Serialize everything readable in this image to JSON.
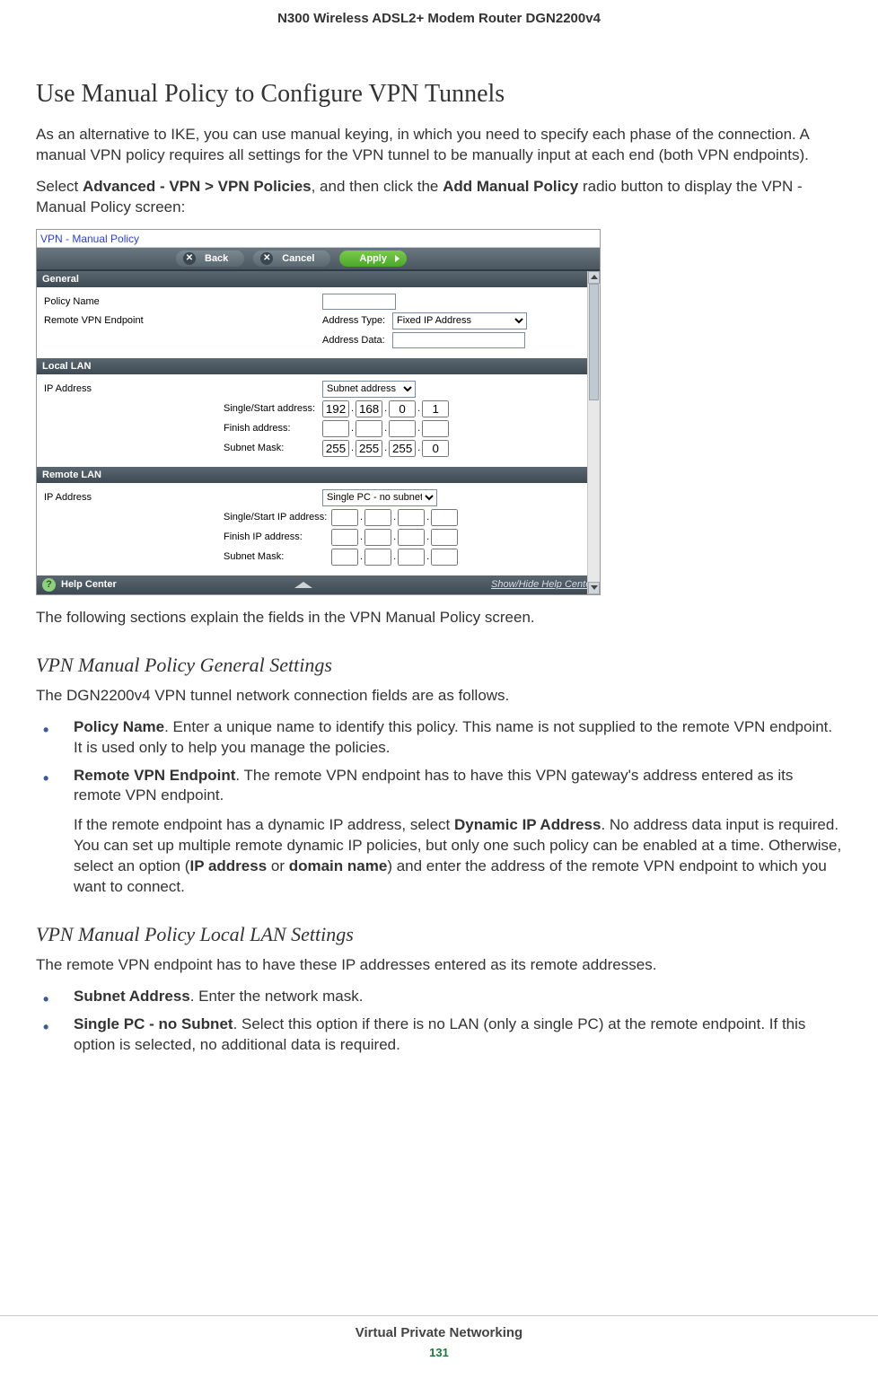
{
  "header": {
    "title": "N300 Wireless ADSL2+ Modem Router DGN2200v4"
  },
  "h1": "Use Manual Policy to Configure VPN Tunnels",
  "para1": "As an alternative to IKE, you can use manual keying, in which you need to specify each phase of the connection. A manual VPN policy requires all settings for the VPN tunnel to be manually input at each end (both VPN endpoints).",
  "para2_pre": "Select ",
  "para2_b1": "Advanced - VPN > VPN Policies",
  "para2_mid": ", and then click the ",
  "para2_b2": "Add Manual Policy",
  "para2_post": " radio button to display the VPN - Manual Policy screen:",
  "ui": {
    "title": "VPN - Manual Policy",
    "btn_back": "Back",
    "btn_cancel": "Cancel",
    "btn_apply": "Apply",
    "sec_general": "General",
    "lbl_policy_name": "Policy Name",
    "lbl_remote_ep": "Remote VPN Endpoint",
    "lbl_addr_type": "Address Type:",
    "sel_addr_type": "Fixed IP Address",
    "lbl_addr_data": "Address Data:",
    "sec_local": "Local LAN",
    "lbl_ip_addr": "IP Address",
    "sel_subnet": "Subnet address",
    "lbl_start": "Single/Start address:",
    "lbl_finish": "Finish address:",
    "lbl_mask": "Subnet Mask:",
    "ip_start": [
      "192",
      "168",
      "0",
      "1"
    ],
    "ip_mask": [
      "255",
      "255",
      "255",
      "0"
    ],
    "sec_remote": "Remote LAN",
    "sel_single": "Single PC - no subnet",
    "lbl_start_ip": "Single/Start IP address:",
    "lbl_finish_ip": "Finish IP address:",
    "help_center": "Help Center",
    "help_toggle": "Show/Hide Help Center"
  },
  "para3": "The following sections explain the fields in the VPN Manual Policy screen.",
  "h2_general": "VPN Manual Policy General Settings",
  "para4": "The DGN2200v4 VPN tunnel network connection fields are as follows.",
  "bul1_b": "Policy Name",
  "bul1_t": ". Enter a unique name to identify this policy. This name is not supplied to the remote VPN endpoint. It is used only to help you manage the policies.",
  "bul2_b": "Remote VPN Endpoint",
  "bul2_t": ". The remote VPN endpoint has to have this VPN gateway's address entered as its remote VPN endpoint.",
  "bul2_p2a": "If the remote endpoint has a dynamic IP address, select ",
  "bul2_p2b1": "Dynamic IP Address",
  "bul2_p2b": ". No address data input is required. You can set up multiple remote dynamic IP policies, but only one such policy can be enabled at a time. Otherwise, select an option (",
  "bul2_p2b2": "IP address",
  "bul2_p2c": " or ",
  "bul2_p2b3": "domain name",
  "bul2_p2d": ") and enter the address of the remote VPN endpoint to which you want to connect.",
  "h2_local": "VPN Manual Policy Local LAN Settings",
  "para5": "The remote VPN endpoint has to have these IP addresses entered as its remote addresses.",
  "bul3_b": "Subnet Address",
  "bul3_t": ". Enter the network mask.",
  "bul4_b": "Single PC - no Subnet",
  "bul4_t": ". Select this option if there is no LAN (only a single PC) at the remote endpoint. If this option is selected, no additional data is required.",
  "footer": {
    "section": "Virtual Private Networking",
    "page": "131"
  }
}
